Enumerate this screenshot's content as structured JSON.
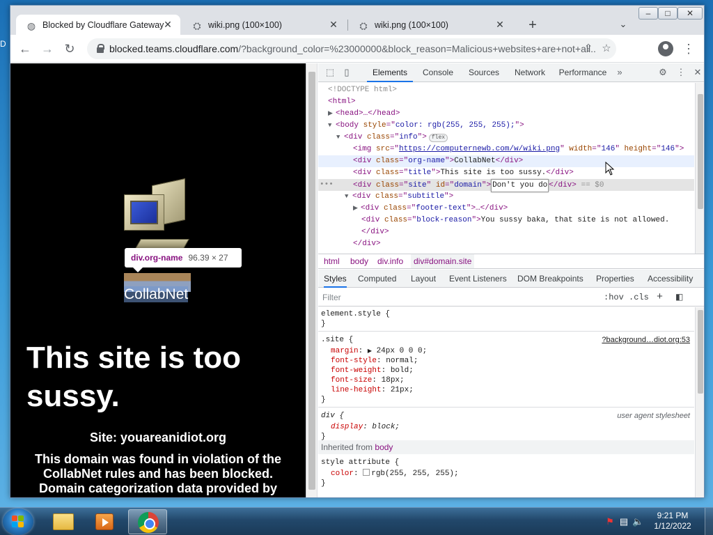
{
  "desktop": {
    "fragment": "D"
  },
  "window": {
    "minimize": "–",
    "maximize": "□",
    "close": "✕"
  },
  "tabs": [
    {
      "title": "Blocked by Cloudflare Gateway",
      "icon": "globe-icon",
      "active": true
    },
    {
      "title": "wiki.png (100×100)",
      "icon": "page-icon",
      "active": false
    },
    {
      "title": "wiki.png (100×100)",
      "icon": "page-icon",
      "active": false
    }
  ],
  "tab_close": "✕",
  "new_tab": "+",
  "tab_search": "⌄",
  "toolbar": {
    "back": "←",
    "forward": "→",
    "reload": "↻",
    "url_host": "blocked.teams.cloudflare.com",
    "url_rest": "/?background_color=%23000000&block_reason=Malicious+websites+are+not+all...",
    "share": "⇪",
    "star": "☆",
    "menu": "⋮"
  },
  "page": {
    "tooltip_tag": "div.org-name",
    "tooltip_size": "96.39 × 27",
    "org_name": "CollabNet",
    "title": "This site is too sussy.",
    "site": "Site: youareanidiot.org",
    "block_reason": "This domain was found in violation of the CollabNet rules and has been blocked. Domain categorization data provided by CloudFlare"
  },
  "devtools": {
    "tabs": [
      "Elements",
      "Console",
      "Sources",
      "Network",
      "Performance"
    ],
    "more": "»",
    "inspect": "⬚",
    "device": "▯",
    "settings": "⚙",
    "kebab": "⋮",
    "close": "✕",
    "dom": {
      "doctype": "<!DOCTYPE html>",
      "html_open": "<html>",
      "head": "<head>…</head>",
      "body_style": "color: rgb(255, 255, 255);",
      "info_class": "info",
      "flex_badge": "flex",
      "img_src": "https://computernewb.com/w/wiki.png",
      "img_width": "146",
      "img_height": "146",
      "org_class": "org-name",
      "org_text": "CollabNet",
      "title_class": "title",
      "title_text": "This site is too sussy.",
      "site_class": "site",
      "site_id": "domain",
      "site_edit": "Don't you do",
      "site_eq": "== $0",
      "subtitle_class": "subtitle",
      "footer_class": "footer-text",
      "reason_class": "block-reason",
      "reason_text": "You sussy baka, that site is not allowed.",
      "div_close": "</div>",
      "dots": "•••"
    },
    "breadcrumbs": [
      "html",
      "body",
      "div.info",
      "div#domain.site"
    ],
    "subtabs": [
      "Styles",
      "Computed",
      "Layout",
      "Event Listeners",
      "DOM Breakpoints",
      "Properties",
      "Accessibility"
    ],
    "filter_placeholder": "Filter",
    "hov": ":hov",
    "cls": ".cls",
    "plus": "+",
    "styles": {
      "element_style": "element.style {",
      "close_brace": "}",
      "site_selector": ".site {",
      "site_source": "?background…diot.org:53",
      "margin_prop": "margin",
      "margin_val": "24px 0 0 0;",
      "font_style_prop": "font-style",
      "font_style_val": "normal;",
      "font_weight_prop": "font-weight",
      "font_weight_val": "bold;",
      "font_size_prop": "font-size",
      "font_size_val": "18px;",
      "line_height_prop": "line-height",
      "line_height_val": "21px;",
      "div_selector": "div {",
      "ua_label": "user agent stylesheet",
      "display_prop": "display",
      "display_val": "block;",
      "inherited_label": "Inherited from",
      "inherited_tag": "body",
      "style_attr": "style attribute {",
      "color_prop": "color",
      "color_val": "rgb(255, 255, 255);"
    }
  },
  "taskbar": {
    "clock_time": "9:21 PM",
    "clock_date": "1/12/2022"
  },
  "colors": {
    "page_bg": "#000000",
    "devtools_accent": "#1a73e8",
    "tag_color": "#881280"
  }
}
